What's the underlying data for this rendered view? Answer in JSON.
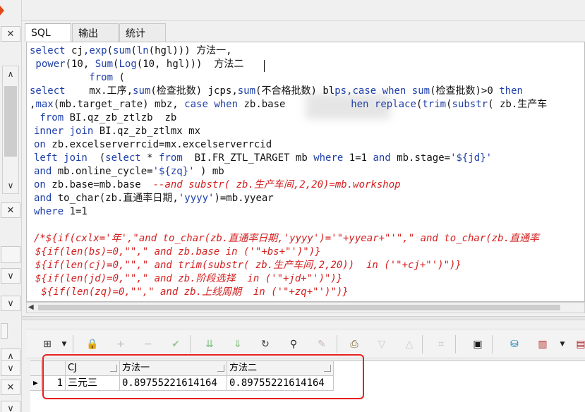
{
  "tabs": [
    {
      "label": "SQL",
      "active": true
    },
    {
      "label": "输出",
      "active": false
    },
    {
      "label": "统计",
      "active": false
    }
  ],
  "sql_lines": [
    [
      {
        "c": "kw",
        "t": "select "
      },
      {
        "c": "tx",
        "t": "cj"
      },
      {
        "c": "kw",
        "t": ","
      },
      {
        "c": "kw",
        "t": "exp"
      },
      {
        "c": "tx",
        "t": "("
      },
      {
        "c": "kw",
        "t": "sum"
      },
      {
        "c": "tx",
        "t": "("
      },
      {
        "c": "kw",
        "t": "ln"
      },
      {
        "c": "tx",
        "t": "(hgl))) 方法一,"
      }
    ],
    [
      {
        "c": "kw",
        "t": " power"
      },
      {
        "c": "tx",
        "t": "(10, "
      },
      {
        "c": "kw",
        "t": "Sum"
      },
      {
        "c": "tx",
        "t": "("
      },
      {
        "c": "kw",
        "t": "Log"
      },
      {
        "c": "tx",
        "t": "(10, hgl)))  方法二"
      }
    ],
    [
      {
        "c": "kw",
        "t": "          from "
      },
      {
        "c": "tx",
        "t": "("
      }
    ],
    [
      {
        "c": "kw",
        "t": "select    "
      },
      {
        "c": "tx",
        "t": "mx.工序,"
      },
      {
        "c": "kw",
        "t": "sum"
      },
      {
        "c": "tx",
        "t": "(检查批数) jcps,"
      },
      {
        "c": "kw",
        "t": "sum"
      },
      {
        "c": "tx",
        "t": "(不合格批数) bl"
      },
      {
        "c": "kw",
        "t": "ps,"
      },
      {
        "c": "kw",
        "t": "case when sum"
      },
      {
        "c": "tx",
        "t": "(检查批数)>0 "
      },
      {
        "c": "kw",
        "t": "then"
      }
    ],
    [
      {
        "c": "tx",
        "t": ","
      },
      {
        "c": "kw",
        "t": "max"
      },
      {
        "c": "tx",
        "t": "(mb.target_rate) mbz, "
      },
      {
        "c": "kw",
        "t": "case when "
      },
      {
        "c": "tx",
        "t": "zb.base           "
      },
      {
        "c": "kw",
        "t": "hen "
      },
      {
        "c": "kw",
        "t": "replace"
      },
      {
        "c": "tx",
        "t": "("
      },
      {
        "c": "kw",
        "t": "trim"
      },
      {
        "c": "tx",
        "t": "("
      },
      {
        "c": "kw",
        "t": "substr"
      },
      {
        "c": "tx",
        "t": "( zb.生产车"
      }
    ],
    [
      {
        "c": "kw",
        "t": " from "
      },
      {
        "c": "tx",
        "t": "BI.qz_zb_ztlzb  zb"
      }
    ],
    [
      {
        "c": "kw",
        "t": "inner join "
      },
      {
        "c": "tx",
        "t": "BI.qz_zb_ztlmx mx"
      }
    ],
    [
      {
        "c": "kw",
        "t": "on "
      },
      {
        "c": "tx",
        "t": "zb.excelserverrcid=mx.excelserverrcid"
      }
    ],
    [
      {
        "c": "kw",
        "t": "left join  "
      },
      {
        "c": "tx",
        "t": "("
      },
      {
        "c": "kw",
        "t": "select "
      },
      {
        "c": "tx",
        "t": "* "
      },
      {
        "c": "kw",
        "t": "from  "
      },
      {
        "c": "tx",
        "t": "BI.FR_ZTL_TARGET mb "
      },
      {
        "c": "kw",
        "t": "where "
      },
      {
        "c": "tx",
        "t": "1=1 "
      },
      {
        "c": "kw",
        "t": "and "
      },
      {
        "c": "tx",
        "t": "mb.stage="
      },
      {
        "c": "st",
        "t": "'${jd}'"
      }
    ],
    [
      {
        "c": "kw",
        "t": "and "
      },
      {
        "c": "tx",
        "t": "mb.online_cycle="
      },
      {
        "c": "st",
        "t": "'${zq}'"
      },
      {
        "c": "tx",
        "t": " ) mb"
      }
    ],
    [
      {
        "c": "kw",
        "t": "on "
      },
      {
        "c": "tx",
        "t": "zb.base=mb.base  "
      },
      {
        "c": "cm",
        "t": "--and substr( zb.生产车间,2,20)=mb.workshop"
      }
    ],
    [
      {
        "c": "kw",
        "t": "and "
      },
      {
        "c": "tx",
        "t": "to_char(zb.直通率日期,"
      },
      {
        "c": "st",
        "t": "'yyyy'"
      },
      {
        "c": "tx",
        "t": ")=mb.yyear"
      }
    ],
    [
      {
        "c": "kw",
        "t": "where "
      },
      {
        "c": "tx",
        "t": "1=1"
      }
    ],
    [
      {
        "c": "tx",
        "t": ""
      }
    ],
    [
      {
        "c": "cm",
        "t": "/*${if(cxlx='年',\"and to_char(zb.直通率日期,'yyyy')='\"+yyear+\"'\",\" and to_char(zb.直通率"
      }
    ],
    [
      {
        "c": "cm",
        "t": "${if(len(bs)=0,\"\",\" and zb.base in ('\"+bs+\"')\")}"
      }
    ],
    [
      {
        "c": "cm",
        "t": "${if(len(cj)=0,\"\",\" and trim(substr( zb.生产车间,2,20))  in ('\"+cj+\"')\")}"
      }
    ],
    [
      {
        "c": "cm",
        "t": "${if(len(jd)=0,\"\",\" and zb.阶段选择  in ('\"+jd+\"')\")}"
      }
    ],
    [
      {
        "c": "cm",
        "t": " ${if(len(zq)=0,\"\",\" and zb.上线周期  in ('\"+zq+\"')\")}"
      }
    ]
  ],
  "result": {
    "columns": [
      "CJ",
      "方法一",
      "方法二"
    ],
    "rows": [
      {
        "num": "1",
        "cells": [
          "三元三",
          "0.89755221614164",
          "0.89755221614164"
        ]
      }
    ]
  },
  "colors": {
    "keyword": "#1f3fa8",
    "comment": "#d42020",
    "highlight": "#e82020"
  }
}
